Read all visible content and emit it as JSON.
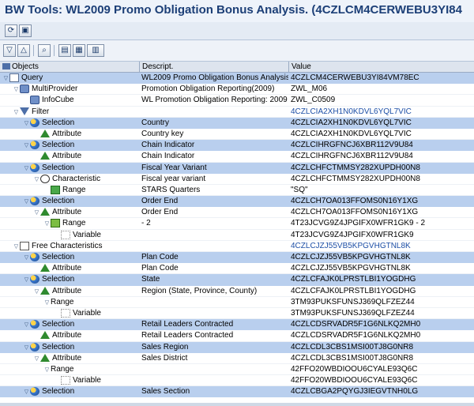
{
  "window": {
    "title": "BW Tools: WL2009 Promo Obligation Bonus Analysis. (4CZLCM4CERWEBU3YI84"
  },
  "toolbar1": [
    {
      "icon": "refresh-icon"
    },
    {
      "icon": "save-icon"
    }
  ],
  "toolbar2": [
    {
      "icon": "expand-all-icon"
    },
    {
      "icon": "collapse-all-icon"
    },
    {
      "icon": "find-icon"
    },
    {
      "icon": "print-icon"
    },
    {
      "icon": "layout-icon"
    },
    {
      "icon": "columns-icon"
    }
  ],
  "columns": {
    "objects": "Objects",
    "descript": "Descript.",
    "value": "Value"
  },
  "rows": [
    {
      "indent": 0,
      "toggle": "▽",
      "icon": "tbl",
      "object": "Query",
      "desc": "WL2009 Promo Obligation Bonus Analysis.",
      "value": "4CZLCM4CERWEBU3YI84VM78EC",
      "highlight": true,
      "vcolor": ""
    },
    {
      "indent": 1,
      "toggle": "▽",
      "icon": "cube",
      "object": "MultiProvider",
      "desc": "Promotion Obligation Reporting(2009)",
      "value": "ZWL_M06",
      "highlight": false,
      "vcolor": ""
    },
    {
      "indent": 2,
      "toggle": "",
      "icon": "cube",
      "object": "InfoCube",
      "desc": "WL Promotion Obligation Reporting: 2009",
      "value": "ZWL_C0509",
      "highlight": false,
      "vcolor": ""
    },
    {
      "indent": 1,
      "toggle": "▽",
      "icon": "filter",
      "object": "Filter",
      "desc": "",
      "value": "4CZLCIA2XH1N0KDVL6YQL7VIC",
      "highlight": false,
      "vcolor": "blue"
    },
    {
      "indent": 2,
      "toggle": "▽",
      "icon": "sel",
      "object": "Selection",
      "desc": "Country",
      "value": "4CZLCIA2XH1N0KDVL6YQL7VIC",
      "highlight": true,
      "vcolor": ""
    },
    {
      "indent": 3,
      "toggle": "",
      "icon": "attr",
      "object": "Attribute",
      "desc": "Country key",
      "value": "4CZLCIA2XH1N0KDVL6YQL7VIC",
      "highlight": false,
      "vcolor": ""
    },
    {
      "indent": 2,
      "toggle": "▽",
      "icon": "sel",
      "object": "Selection",
      "desc": "Chain Indicator",
      "value": "4CZLCIHRGFNCJ6XBR112V9U84",
      "highlight": true,
      "vcolor": ""
    },
    {
      "indent": 3,
      "toggle": "",
      "icon": "attr",
      "object": "Attribute",
      "desc": "Chain Indicator",
      "value": "4CZLCIHRGFNCJ6XBR112V9U84",
      "highlight": false,
      "vcolor": ""
    },
    {
      "indent": 2,
      "toggle": "▽",
      "icon": "sel",
      "object": "Selection",
      "desc": "Fiscal Year Variant",
      "value": "4CZLCHFCTMMSY282XUPDH00N8",
      "highlight": true,
      "vcolor": ""
    },
    {
      "indent": 3,
      "toggle": "▽",
      "icon": "clock",
      "object": "Characteristic",
      "desc": "Fiscal year variant",
      "value": "4CZLCHFCTMMSY282XUPDH00N8",
      "highlight": false,
      "vcolor": ""
    },
    {
      "indent": 4,
      "toggle": "",
      "icon": "rangeeq",
      "object": "Range",
      "desc": "STARS Quarters",
      "value": "\"SQ\"",
      "highlight": false,
      "vcolor": ""
    },
    {
      "indent": 2,
      "toggle": "▽",
      "icon": "sel",
      "object": "Selection",
      "desc": "Order End",
      "value": "4CZLCH7OA013FFOMS0N16Y1XG",
      "highlight": true,
      "vcolor": ""
    },
    {
      "indent": 3,
      "toggle": "▽",
      "icon": "attr",
      "object": "Attribute",
      "desc": "Order End",
      "value": "4CZLCH7OA013FFOMS0N16Y1XG",
      "highlight": false,
      "vcolor": ""
    },
    {
      "indent": 4,
      "toggle": "▽",
      "icon": "rangelt",
      "object": "Range",
      "desc": "- 2",
      "value": "4T23JCVG9Z4JPGIFX0WFR1GK9 - 2",
      "highlight": false,
      "vcolor": ""
    },
    {
      "indent": 5,
      "toggle": "",
      "icon": "var",
      "object": "Variable",
      "desc": "",
      "value": "4T23JCVG9Z4JPGIFX0WFR1GK9",
      "highlight": false,
      "vcolor": ""
    },
    {
      "indent": 1,
      "toggle": "▽",
      "icon": "free",
      "object": "Free Characteristics",
      "desc": "",
      "value": "4CZLCJZJ55VB5KPGVHGTNL8K",
      "highlight": false,
      "vcolor": "blue"
    },
    {
      "indent": 2,
      "toggle": "▽",
      "icon": "sel",
      "object": "Selection",
      "desc": "Plan Code",
      "value": "4CZLCJZJ55VB5KPGVHGTNL8K",
      "highlight": true,
      "vcolor": ""
    },
    {
      "indent": 3,
      "toggle": "",
      "icon": "attr",
      "object": "Attribute",
      "desc": "Plan Code",
      "value": "4CZLCJZJ55VB5KPGVHGTNL8K",
      "highlight": false,
      "vcolor": ""
    },
    {
      "indent": 2,
      "toggle": "▽",
      "icon": "sel",
      "object": "Selection",
      "desc": "State",
      "value": "4CZLCFAJK0LPRSTLBI1YOGDHG",
      "highlight": true,
      "vcolor": ""
    },
    {
      "indent": 3,
      "toggle": "▽",
      "icon": "attr",
      "object": "Attribute",
      "desc": "Region (State, Province, County)",
      "value": "4CZLCFAJK0LPRSTLBI1YOGDHG",
      "highlight": false,
      "vcolor": ""
    },
    {
      "indent": 4,
      "toggle": "▽",
      "icon": "",
      "object": "Range",
      "desc": "",
      "value": "3TM93PUKSFUNSJ369QLFZEZ44",
      "highlight": false,
      "vcolor": ""
    },
    {
      "indent": 5,
      "toggle": "",
      "icon": "var",
      "object": "Variable",
      "desc": "",
      "value": "3TM93PUKSFUNSJ369QLFZEZ44",
      "highlight": false,
      "vcolor": ""
    },
    {
      "indent": 2,
      "toggle": "▽",
      "icon": "sel",
      "object": "Selection",
      "desc": "Retail Leaders Contracted",
      "value": "4CZLCDSRVADR5F1G6NLKQ2MH0",
      "highlight": true,
      "vcolor": ""
    },
    {
      "indent": 3,
      "toggle": "",
      "icon": "attr",
      "object": "Attribute",
      "desc": "Retail Leaders Contracted",
      "value": "4CZLCDSRVADR5F1G6NLKQ2MH0",
      "highlight": false,
      "vcolor": ""
    },
    {
      "indent": 2,
      "toggle": "▽",
      "icon": "sel",
      "object": "Selection",
      "desc": "Sales Region",
      "value": "4CZLCDL3CBS1MSI00TJ8G0NR8",
      "highlight": true,
      "vcolor": ""
    },
    {
      "indent": 3,
      "toggle": "▽",
      "icon": "attr",
      "object": "Attribute",
      "desc": "Sales District",
      "value": "4CZLCDL3CBS1MSI00TJ8G0NR8",
      "highlight": false,
      "vcolor": ""
    },
    {
      "indent": 4,
      "toggle": "▽",
      "icon": "",
      "object": "Range",
      "desc": "",
      "value": "42FFO20WBDIOOU6CYALE93Q6C",
      "highlight": false,
      "vcolor": ""
    },
    {
      "indent": 5,
      "toggle": "",
      "icon": "var",
      "object": "Variable",
      "desc": "",
      "value": "42FFO20WBDIOOU6CYALE93Q6C",
      "highlight": false,
      "vcolor": ""
    },
    {
      "indent": 2,
      "toggle": "▽",
      "icon": "sel",
      "object": "Selection",
      "desc": "Sales Section",
      "value": "4CZLCBGA2PQYGJ3IEGVTNH0LG",
      "highlight": true,
      "vcolor": ""
    }
  ]
}
